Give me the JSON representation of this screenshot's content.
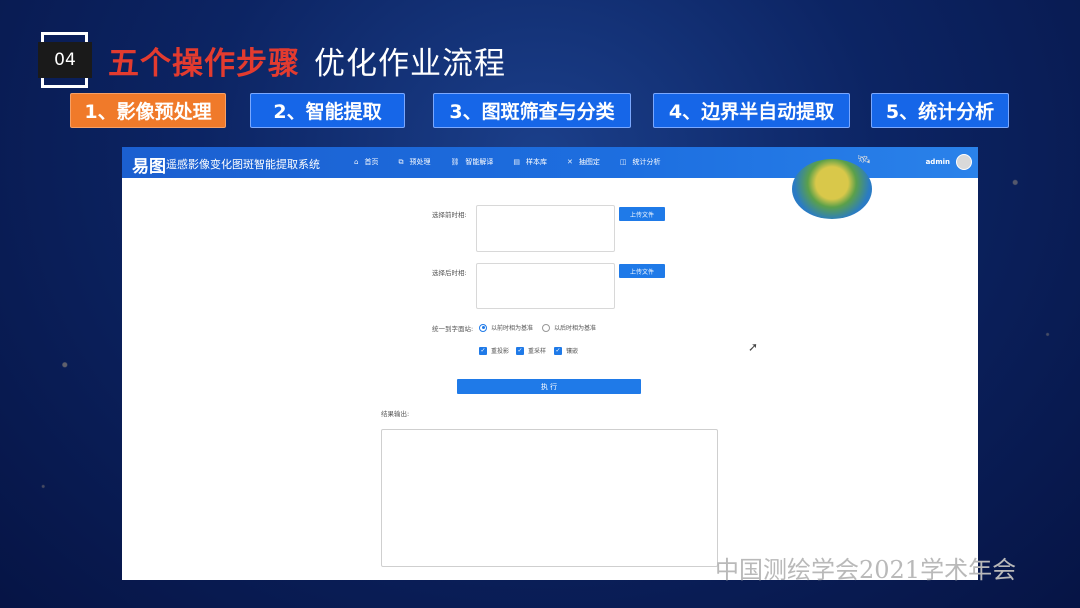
{
  "slide": {
    "number": "04",
    "title_red": "五个操作步骤",
    "title_white": "优化作业流程",
    "footer": "中国测绘学会2021学术年会"
  },
  "steps": [
    {
      "label": "1、影像预处理",
      "active": true
    },
    {
      "label": "2、智能提取",
      "active": false
    },
    {
      "label": "3、图斑筛查与分类",
      "active": false
    },
    {
      "label": "4、边界半自动提取",
      "active": false
    },
    {
      "label": "5、统计分析",
      "active": false
    }
  ],
  "app": {
    "logo": "易图",
    "system_title": "遥感影像变化图斑智能提取系统",
    "nav": [
      {
        "icon": "home-icon",
        "glyph": "⌂",
        "label": "首页"
      },
      {
        "icon": "preprocess-icon",
        "glyph": "⧉",
        "label": "预处理"
      },
      {
        "icon": "link-icon",
        "glyph": "⛓",
        "label": "智能解译"
      },
      {
        "icon": "doc-icon",
        "glyph": "▤",
        "label": "样本库"
      },
      {
        "icon": "cross-icon",
        "glyph": "✕",
        "label": "抽图定"
      },
      {
        "icon": "chart-icon",
        "glyph": "◫",
        "label": "统计分析"
      }
    ],
    "user": "admin",
    "form": {
      "before_label": "选择前时相:",
      "after_label": "选择后时相:",
      "upload_label": "上传文件",
      "unify_label": "统一到字面站:",
      "radio_options": [
        "以前时相为基准",
        "以后时相为基准"
      ],
      "checkboxes": [
        "重投影",
        "重采样",
        "镶嵌"
      ],
      "run_label": "执 行",
      "result_label": "结果输出:"
    }
  }
}
